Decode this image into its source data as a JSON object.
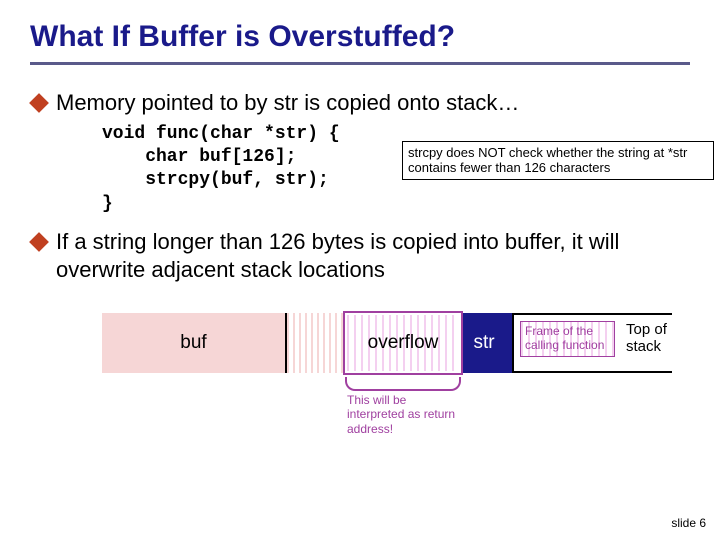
{
  "title": "What If Buffer is Overstuffed?",
  "bullets": {
    "b1": "Memory pointed to by str is copied onto stack…",
    "b2": "If a string longer than 126 bytes is copied into buffer, it will overwrite adjacent stack locations"
  },
  "code": {
    "l1": "void func(char *str) {",
    "l2": "    char buf[126];",
    "l3": "    strcpy(buf, str);",
    "l4": "}"
  },
  "callout": "strcpy does NOT check whether the string at *str contains fewer than 126 characters",
  "stack": {
    "buf": "buf",
    "overflow": "overflow",
    "str": "str",
    "frame": "Frame of the calling function",
    "top": "Top of stack"
  },
  "note": "This will be interpreted as return address!",
  "footer": "slide 6"
}
